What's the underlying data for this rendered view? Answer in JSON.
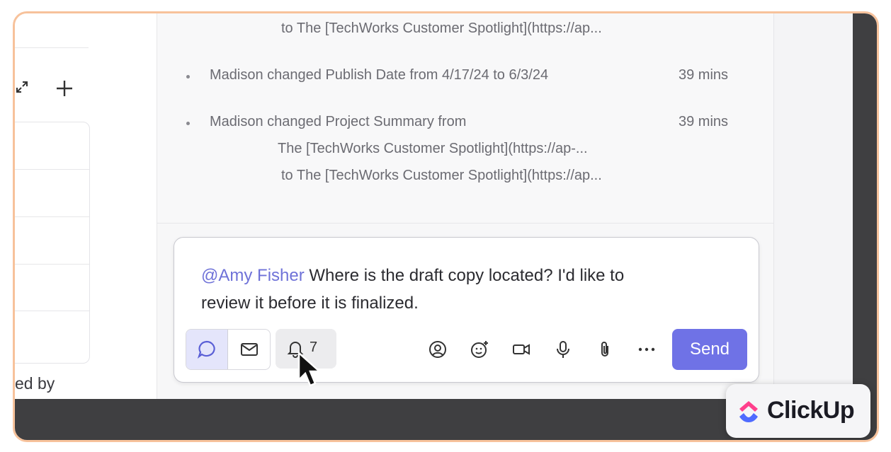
{
  "left_panel": {
    "created_by_fragment": "ed by"
  },
  "activity": {
    "entries": [
      {
        "text": "",
        "continuation": [
          "to  The [TechWorks Customer Spotlight](https://ap..."
        ],
        "time": ""
      },
      {
        "text": "Madison changed Publish Date from 4/17/24 to 6/3/24",
        "continuation": [],
        "time": "39 mins"
      },
      {
        "text": "Madison changed Project Summary from",
        "continuation": [
          "The [TechWorks Customer Spotlight](https://ap-...",
          "to  The [TechWorks Customer Spotlight](https://ap..."
        ],
        "time": "39 mins"
      }
    ]
  },
  "comment": {
    "mention": "@Amy Fisher",
    "body_line1": " Where is the draft copy located? I'd like to",
    "body_line2": "review it before it is finalized.",
    "bell_count": "7",
    "send_label": "Send",
    "toolbar_icons": [
      "mention-icon",
      "emoji-icon",
      "video-icon",
      "microphone-icon",
      "attachment-icon",
      "more-icon"
    ]
  },
  "brand": {
    "name": "ClickUp",
    "accent": "#6f72e6"
  }
}
